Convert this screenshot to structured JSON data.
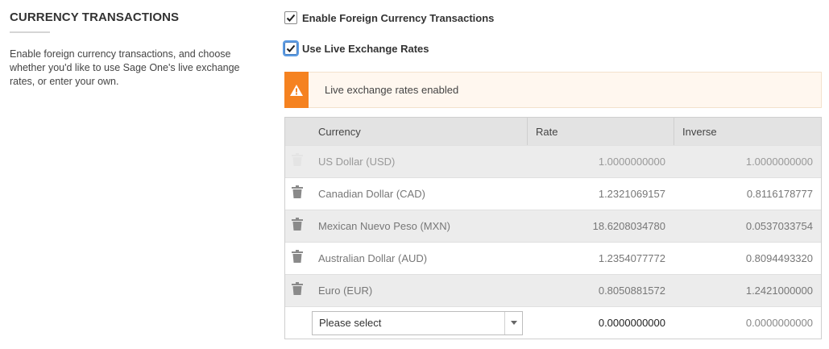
{
  "section": {
    "title": "CURRENCY TRANSACTIONS",
    "description": "Enable foreign currency transactions, and choose whether you'd like to use Sage One's live exchange rates, or enter your own."
  },
  "options": {
    "enable_foreign": {
      "label": "Enable Foreign Currency Transactions",
      "checked": true
    },
    "live_rates": {
      "label": "Use Live Exchange Rates",
      "checked": true
    }
  },
  "alert": {
    "text": "Live exchange rates enabled",
    "icon": "warning-icon",
    "color": "#f58220"
  },
  "table": {
    "headers": {
      "currency": "Currency",
      "rate": "Rate",
      "inverse": "Inverse"
    },
    "rows": [
      {
        "currency": "US Dollar (USD)",
        "rate": "1.0000000000",
        "inverse": "1.0000000000",
        "deletable": false
      },
      {
        "currency": "Canadian Dollar (CAD)",
        "rate": "1.2321069157",
        "inverse": "0.8116178777",
        "deletable": true
      },
      {
        "currency": "Mexican Nuevo Peso (MXN)",
        "rate": "18.6208034780",
        "inverse": "0.0537033754",
        "deletable": true
      },
      {
        "currency": "Australian Dollar (AUD)",
        "rate": "1.2354077772",
        "inverse": "0.8094493320",
        "deletable": true
      },
      {
        "currency": "Euro (EUR)",
        "rate": "0.8050881572",
        "inverse": "1.2421000000",
        "deletable": true
      }
    ],
    "new_row": {
      "placeholder": "Please select",
      "rate": "0.0000000000",
      "inverse": "0.0000000000"
    }
  }
}
